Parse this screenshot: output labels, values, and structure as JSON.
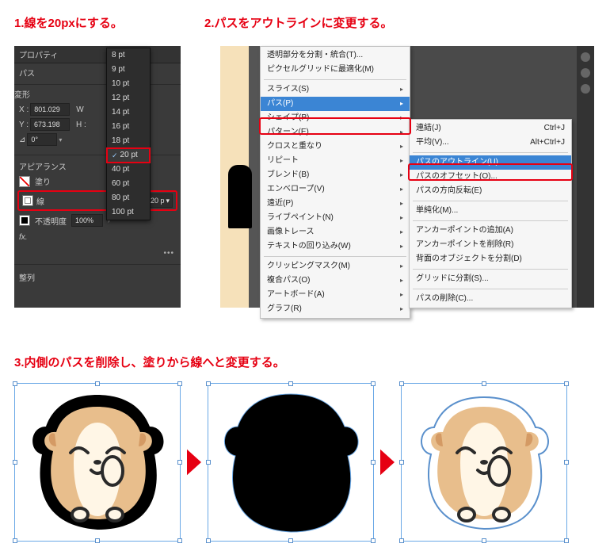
{
  "step1": {
    "caption": "1.線を20pxにする。",
    "panel_title": "プロパティ",
    "path_label": "パス",
    "transform_title": "変形",
    "x_label": "X :",
    "x_value": "801.029",
    "y_label": "Y :",
    "y_value": "673.198",
    "w_label": "W",
    "h_label": "H :",
    "angle_label": "⊿",
    "angle_value": "0°",
    "appearance_title": "アピアランス",
    "fill_label": "塗り",
    "stroke_label": "線",
    "stroke_value": "20 p",
    "opacity_label": "不透明度",
    "opacity_value": "100%",
    "fx_label": "fx.",
    "align_title": "整列",
    "pt_options": [
      "8 pt",
      "9 pt",
      "10 pt",
      "12 pt",
      "14 pt",
      "16 pt",
      "18 pt",
      "20 pt",
      "40 pt",
      "60 pt",
      "80 pt",
      "100 pt"
    ],
    "pt_selected": "20 pt"
  },
  "step2": {
    "caption": "2.パスをアウトラインに変更する。",
    "menuA": {
      "items": [
        "透明部分を分割・統合(T)...",
        "ピクセルグリッドに最適化(M)",
        "スライス(S)",
        "パス(P)",
        "シェイプ(P)",
        "パターン(E)",
        "クロスと重なり",
        "リピート",
        "ブレンド(B)",
        "エンベロープ(V)",
        "遠近(P)",
        "ライブペイント(N)",
        "画像トレース",
        "テキストの回り込み(W)",
        "クリッピングマスク(M)",
        "複合パス(O)",
        "アートボード(A)",
        "グラフ(R)"
      ],
      "highlight": "パス(P)"
    },
    "menuB": {
      "items": [
        {
          "label": "連結(J)",
          "shortcut": "Ctrl+J"
        },
        {
          "label": "平均(V)...",
          "shortcut": "Alt+Ctrl+J"
        },
        {
          "label": "パスのアウトライン(U)",
          "shortcut": ""
        },
        {
          "label": "パスのオフセット(O)...",
          "shortcut": ""
        },
        {
          "label": "パスの方向反転(E)",
          "shortcut": ""
        },
        {
          "label": "単純化(M)...",
          "shortcut": ""
        },
        {
          "label": "アンカーポイントの追加(A)",
          "shortcut": ""
        },
        {
          "label": "アンカーポイントを削除(R)",
          "shortcut": ""
        },
        {
          "label": "背面のオブジェクトを分割(D)",
          "shortcut": ""
        },
        {
          "label": "グリッドに分割(S)...",
          "shortcut": ""
        },
        {
          "label": "パスの削除(C)...",
          "shortcut": ""
        }
      ],
      "highlight": "パスのアウトライン(U)"
    }
  },
  "step3": {
    "caption": "3.内側のパスを削除し、塗りから線へと変更する。"
  }
}
